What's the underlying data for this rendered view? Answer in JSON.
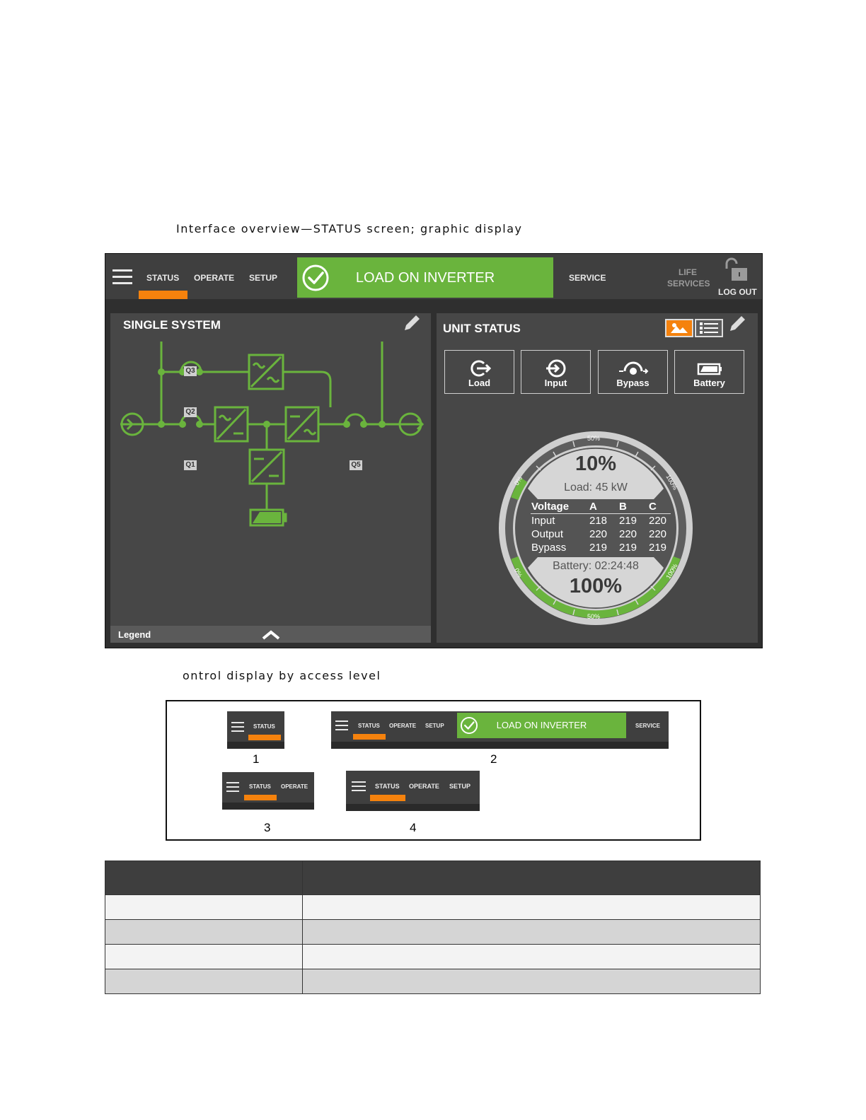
{
  "captions": {
    "figure1": "Interface overview—STATUS screen; graphic display",
    "figure2": "ontrol display by access level"
  },
  "topbar": {
    "menu_icon": "hamburger-menu-icon",
    "tabs": [
      {
        "label": "STATUS",
        "active": true
      },
      {
        "label": "OPERATE",
        "active": false
      },
      {
        "label": "SETUP",
        "active": false
      }
    ],
    "status_banner": {
      "label": "LOAD ON INVERTER",
      "icon": "check-circle-icon",
      "color": "#6ab43d"
    },
    "service_label": "SERVICE",
    "life_services_line1": "LIFE",
    "life_services_line2": "SERVICES",
    "logout_label": "LOG OUT",
    "logout_icon": "unlocked-padlock-icon",
    "accent_color": "#f5820d"
  },
  "single_system": {
    "title": "SINGLE SYSTEM",
    "edit_icon": "pencil-icon",
    "breakers": {
      "q1": "Q1",
      "q2": "Q2",
      "q3": "Q3",
      "q5": "Q5"
    },
    "legend_label": "Legend",
    "legend_icon": "chevron-up-icon",
    "line_color": "#6ab43d"
  },
  "unit_status": {
    "title": "UNIT STATUS",
    "view_icons": [
      "graphic-view-icon",
      "list-view-icon",
      "pencil-icon"
    ],
    "buttons": [
      {
        "label": "Load",
        "icon": "load-icon"
      },
      {
        "label": "Input",
        "icon": "input-icon"
      },
      {
        "label": "Bypass",
        "icon": "bypass-icon"
      },
      {
        "label": "Battery",
        "icon": "battery-icon"
      }
    ],
    "gauge": {
      "load_percent": "10%",
      "load_value": 10,
      "load_kw": "Load: 45 kW",
      "battery_time": "Battery: 02:24:48",
      "battery_percent": "100%",
      "battery_value": 100,
      "scale_top_mid": "50%",
      "scale_top_left": "0%",
      "scale_top_right": "100%",
      "scale_bottom_mid": "50%",
      "scale_bottom_left": "0%",
      "scale_bottom_right": "100%"
    },
    "voltage_table": {
      "headers": [
        "Voltage",
        "A",
        "B",
        "C"
      ],
      "rows": [
        [
          "Input",
          "218",
          "219",
          "220"
        ],
        [
          "Output",
          "220",
          "220",
          "220"
        ],
        [
          "Bypass",
          "219",
          "219",
          "219"
        ]
      ]
    }
  },
  "access_levels": {
    "numbers": [
      "1",
      "2",
      "3",
      "4"
    ],
    "level1": {
      "tabs": [
        "STATUS"
      ]
    },
    "level2": {
      "tabs": [
        "STATUS",
        "OPERATE",
        "SETUP"
      ],
      "banner": "LOAD ON INVERTER",
      "service": "SERVICE"
    },
    "level3": {
      "tabs": [
        "STATUS",
        "OPERATE"
      ]
    },
    "level4": {
      "tabs": [
        "STATUS",
        "OPERATE",
        "SETUP"
      ]
    }
  }
}
